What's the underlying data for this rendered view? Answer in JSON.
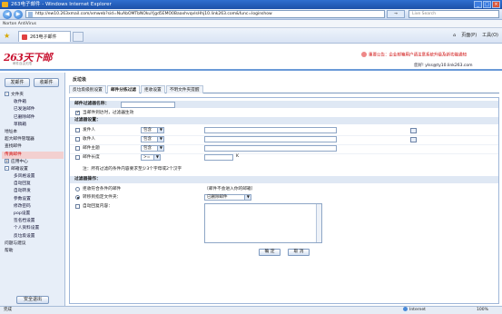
{
  "window": {
    "title": "263电子邮件 - Windows Internet Explorer",
    "controls": [
      "_",
      "□",
      "×"
    ]
  },
  "addressbar": {
    "url": "http://ew10.263xmail.com/xmweb?sid=NuAbOMTbNOkuYjgd5EMO0BaaxhvqvlsHhj10.link263.com&func=loginshow",
    "go_label": "→",
    "search_placeholder": "Live Search"
  },
  "linksbar": {
    "text": "Norton AntiVirus"
  },
  "tabs": {
    "active_label": "263电子邮件"
  },
  "tools": {
    "home": "⌂",
    "page": "页面(P)",
    "tools": "工具(O)"
  },
  "header": {
    "logo": "263天下邮",
    "logo_sub": "邮件自由无限",
    "notice": "重要公告：企业邮箱用户请注意系统升级及新功能通知",
    "user": "您好! ylss@ty10.link263.com"
  },
  "sidebar": {
    "write_label": "发邮件",
    "recv_label": "收邮件",
    "items": [
      {
        "label": "文件夹",
        "level": 1,
        "toggle": "-"
      },
      {
        "label": "收件箱",
        "level": 2
      },
      {
        "label": "已发送邮件",
        "level": 2
      },
      {
        "label": "已删除邮件",
        "level": 2
      },
      {
        "label": "草稿箱",
        "level": 2
      },
      {
        "label": "地址本",
        "level": 1
      },
      {
        "label": "超大邮件管理器",
        "level": 1
      },
      {
        "label": "查找邮件",
        "level": 1
      },
      {
        "label": "传真邮件",
        "level": 1,
        "highlight": true
      },
      {
        "label": "应用中心",
        "level": 1,
        "toggle": "+"
      },
      {
        "label": "邮箱设置",
        "level": 1,
        "toggle": "-"
      },
      {
        "label": "多风格设置",
        "level": 2
      },
      {
        "label": "自动回复",
        "level": 2
      },
      {
        "label": "自动转发",
        "level": 2
      },
      {
        "label": "参数设置",
        "level": 2
      },
      {
        "label": "修改密码",
        "level": 2
      },
      {
        "label": "pop设置",
        "level": 2
      },
      {
        "label": "签名档设置",
        "level": 2
      },
      {
        "label": "个人资料设置",
        "level": 2
      },
      {
        "label": "反垃圾设置",
        "level": 2
      },
      {
        "label": "问题与建议",
        "level": 1
      },
      {
        "label": "帮助",
        "level": 1
      }
    ],
    "logout_label": "安全退出"
  },
  "content": {
    "title": "反垃圾",
    "tabs": [
      "反垃圾级别设置",
      "邮件分拣过滤",
      "拒收设置",
      "不明文件夹提醒"
    ],
    "active_tab": 1,
    "name_section": "邮件过滤器名称：",
    "apply_label": "当邮件到达时，过滤器生效",
    "condition_section": "过滤器设置：",
    "conditions": [
      {
        "field": "发件人",
        "op": "包含",
        "book": true
      },
      {
        "field": "收件人",
        "op": "包含",
        "book": true
      },
      {
        "field": "邮件主题",
        "op": "包含",
        "book": false
      }
    ],
    "size_row": {
      "field": "邮件长度",
      "op": ">=",
      "unit": "K"
    },
    "hint": "注：所有过滤的条件内容要求至少3个字母或2个汉字",
    "action_section": "过滤器操作：",
    "actions": {
      "reject": "拒收符合条件的邮件",
      "reject_note": "（邮件不会进入你的邮箱）",
      "move": "转移到指定文件夹：",
      "move_target": "已删除邮件",
      "autoreply": "自动回复内容："
    },
    "ok_label": "确 定",
    "cancel_label": "取 消"
  },
  "status": {
    "done": "完成",
    "zone": "Internet",
    "zoom": "100%"
  }
}
